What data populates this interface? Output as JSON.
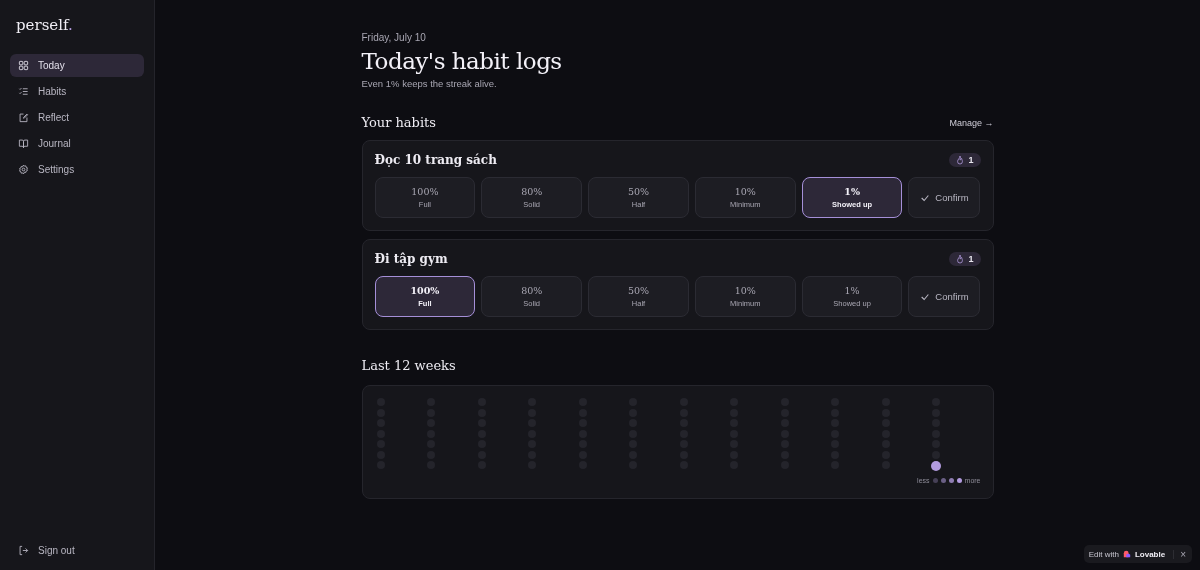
{
  "sidebar": {
    "logo": "perself",
    "logo_dot": ".",
    "items": [
      {
        "label": "Today",
        "selected": true
      },
      {
        "label": "Habits",
        "selected": false
      },
      {
        "label": "Reflect",
        "selected": false
      },
      {
        "label": "Journal",
        "selected": false
      },
      {
        "label": "Settings",
        "selected": false
      }
    ],
    "sign_out": "Sign out"
  },
  "header": {
    "date": "Friday, July 10",
    "title": "Today's habit logs",
    "subtitle": "Even 1% keeps the streak alive."
  },
  "habits_section": {
    "title": "Your habits",
    "link": "Manage →"
  },
  "habits": [
    {
      "name": "Đọc 10 trang sách",
      "streak": "1",
      "options": [
        {
          "percent": "100%",
          "label": "Full",
          "selected": false
        },
        {
          "percent": "80%",
          "label": "Solid",
          "selected": false
        },
        {
          "percent": "50%",
          "label": "Half",
          "selected": false
        },
        {
          "percent": "10%",
          "label": "Minimum",
          "selected": false
        },
        {
          "percent": "1%",
          "label": "Showed up",
          "selected": true
        }
      ],
      "confirm": "Confirm"
    },
    {
      "name": "Đi tập gym",
      "streak": "1",
      "options": [
        {
          "percent": "100%",
          "label": "Full",
          "selected": true
        },
        {
          "percent": "80%",
          "label": "Solid",
          "selected": false
        },
        {
          "percent": "50%",
          "label": "Half",
          "selected": false
        },
        {
          "percent": "10%",
          "label": "Minimum",
          "selected": false
        },
        {
          "percent": "1%",
          "label": "Showed up",
          "selected": false
        }
      ],
      "confirm": "Confirm"
    }
  ],
  "history": {
    "title": "Last 12 weeks",
    "weeks": [
      {
        "days": [
          {
            "logged": false
          },
          {
            "logged": false
          },
          {
            "logged": false
          },
          {
            "logged": false
          },
          {
            "logged": false
          },
          {
            "logged": false
          },
          {
            "logged": false
          }
        ]
      },
      {
        "days": [
          {
            "logged": false
          },
          {
            "logged": false
          },
          {
            "logged": false
          },
          {
            "logged": false
          },
          {
            "logged": false
          },
          {
            "logged": false
          },
          {
            "logged": false
          }
        ]
      },
      {
        "days": [
          {
            "logged": false
          },
          {
            "logged": false
          },
          {
            "logged": false
          },
          {
            "logged": false
          },
          {
            "logged": false
          },
          {
            "logged": false
          },
          {
            "logged": false
          }
        ]
      },
      {
        "days": [
          {
            "logged": false
          },
          {
            "logged": false
          },
          {
            "logged": false
          },
          {
            "logged": false
          },
          {
            "logged": false
          },
          {
            "logged": false
          },
          {
            "logged": false
          }
        ]
      },
      {
        "days": [
          {
            "logged": false
          },
          {
            "logged": false
          },
          {
            "logged": false
          },
          {
            "logged": false
          },
          {
            "logged": false
          },
          {
            "logged": false
          },
          {
            "logged": false
          }
        ]
      },
      {
        "days": [
          {
            "logged": false
          },
          {
            "logged": false
          },
          {
            "logged": false
          },
          {
            "logged": false
          },
          {
            "logged": false
          },
          {
            "logged": false
          },
          {
            "logged": false
          }
        ]
      },
      {
        "days": [
          {
            "logged": false
          },
          {
            "logged": false
          },
          {
            "logged": false
          },
          {
            "logged": false
          },
          {
            "logged": false
          },
          {
            "logged": false
          },
          {
            "logged": false
          }
        ]
      },
      {
        "days": [
          {
            "logged": false
          },
          {
            "logged": false
          },
          {
            "logged": false
          },
          {
            "logged": false
          },
          {
            "logged": false
          },
          {
            "logged": false
          },
          {
            "logged": false
          }
        ]
      },
      {
        "days": [
          {
            "logged": false
          },
          {
            "logged": false
          },
          {
            "logged": false
          },
          {
            "logged": false
          },
          {
            "logged": false
          },
          {
            "logged": false
          },
          {
            "logged": false
          }
        ]
      },
      {
        "days": [
          {
            "logged": false
          },
          {
            "logged": false
          },
          {
            "logged": false
          },
          {
            "logged": false
          },
          {
            "logged": false
          },
          {
            "logged": false
          },
          {
            "logged": false
          }
        ]
      },
      {
        "days": [
          {
            "logged": false
          },
          {
            "logged": false
          },
          {
            "logged": false
          },
          {
            "logged": false
          },
          {
            "logged": false
          },
          {
            "logged": false
          },
          {
            "logged": false
          }
        ]
      },
      {
        "days": [
          {
            "logged": false
          },
          {
            "logged": false
          },
          {
            "logged": false
          },
          {
            "logged": false
          },
          {
            "logged": false
          },
          {
            "logged": false
          },
          {
            "logged": true
          }
        ]
      }
    ],
    "legend": {
      "less": "less",
      "more": "more"
    }
  },
  "badge": {
    "text": "Edit with",
    "brand": "Lovable",
    "close": "×"
  }
}
